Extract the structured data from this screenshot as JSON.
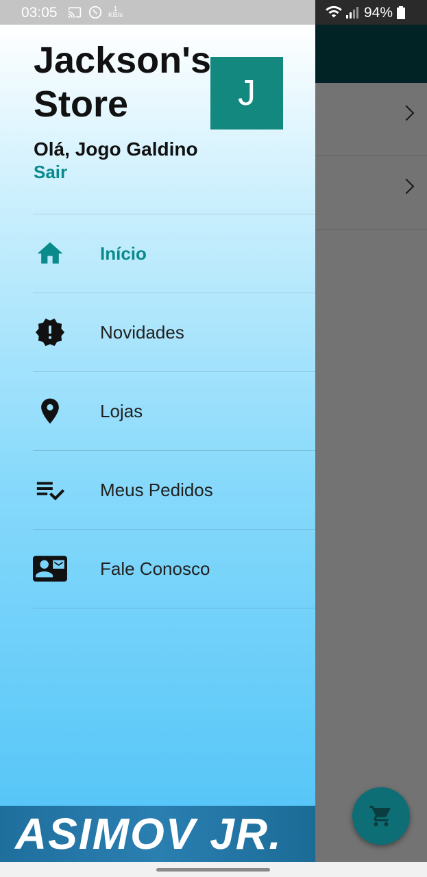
{
  "status_bar": {
    "time": "03:05",
    "kbs_value": "1",
    "kbs_unit": "KB/s",
    "battery": "94%"
  },
  "drawer": {
    "store_title": "Jackson's Store",
    "avatar_letter": "J",
    "greeting": "Olá, Jogo Galdino",
    "logout": "Sair",
    "items": [
      {
        "label": "Início",
        "icon": "home-icon",
        "active": true
      },
      {
        "label": "Novidades",
        "icon": "new-releases-icon",
        "active": false
      },
      {
        "label": "Lojas",
        "icon": "location-pin-icon",
        "active": false
      },
      {
        "label": "Meus Pedidos",
        "icon": "playlist-check-icon",
        "active": false
      },
      {
        "label": "Fale Conosco",
        "icon": "contact-mail-icon",
        "active": false
      }
    ],
    "accent_color": "#0a8a8a"
  },
  "watermark": {
    "text": "ASIMOV JR."
  },
  "fab": {
    "icon": "shopping-cart-icon"
  }
}
